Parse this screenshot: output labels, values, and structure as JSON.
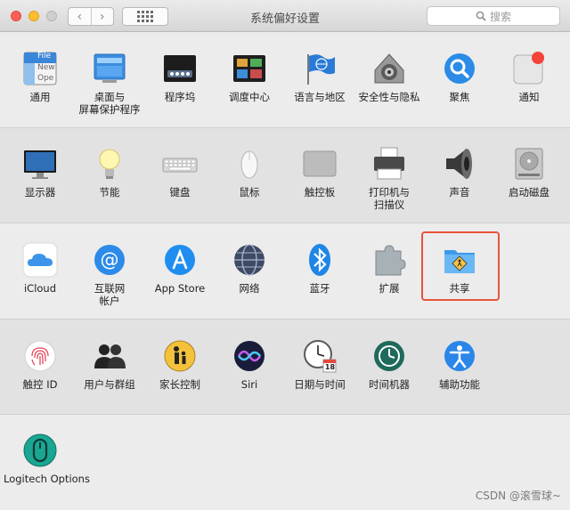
{
  "window": {
    "title": "系统偏好设置",
    "search_placeholder": "搜索",
    "back": "‹",
    "forward": "›"
  },
  "rows": [
    [
      {
        "name": "通用",
        "icon": "general-icon"
      },
      {
        "name": "桌面与\n屏幕保护程序",
        "icon": "desktop-icon"
      },
      {
        "name": "程序坞",
        "icon": "dock-icon"
      },
      {
        "name": "调度中心",
        "icon": "mission-control-icon"
      },
      {
        "name": "语言与地区",
        "icon": "flag-icon"
      },
      {
        "name": "安全性与隐私",
        "icon": "security-icon"
      },
      {
        "name": "聚焦",
        "icon": "spotlight-icon"
      },
      {
        "name": "通知",
        "icon": "notification-icon"
      }
    ],
    [
      {
        "name": "显示器",
        "icon": "display-icon"
      },
      {
        "name": "节能",
        "icon": "bulb-icon"
      },
      {
        "name": "键盘",
        "icon": "keyboard-icon"
      },
      {
        "name": "鼠标",
        "icon": "mouse-icon"
      },
      {
        "name": "触控板",
        "icon": "trackpad-icon"
      },
      {
        "name": "打印机与\n扫描仪",
        "icon": "printer-icon"
      },
      {
        "name": "声音",
        "icon": "speaker-icon"
      },
      {
        "name": "启动磁盘",
        "icon": "disk-icon"
      }
    ],
    [
      {
        "name": "iCloud",
        "icon": "cloud-icon"
      },
      {
        "name": "互联网\n帐户",
        "icon": "at-icon"
      },
      {
        "name": "App Store",
        "icon": "appstore-icon"
      },
      {
        "name": "网络",
        "icon": "globe-icon"
      },
      {
        "name": "蓝牙",
        "icon": "bluetooth-icon"
      },
      {
        "name": "扩展",
        "icon": "puzzle-icon"
      },
      {
        "name": "共享",
        "icon": "sharing-folder-icon"
      }
    ],
    [
      {
        "name": "触控 ID",
        "icon": "fingerprint-icon"
      },
      {
        "name": "用户与群组",
        "icon": "users-icon"
      },
      {
        "name": "家长控制",
        "icon": "parental-icon"
      },
      {
        "name": "Siri",
        "icon": "siri-icon"
      },
      {
        "name": "日期与时间",
        "icon": "clock-icon"
      },
      {
        "name": "时间机器",
        "icon": "time-machine-icon"
      },
      {
        "name": "辅助功能",
        "icon": "accessibility-icon"
      }
    ],
    [
      {
        "name": "Logitech Options",
        "icon": "logitech-icon"
      }
    ]
  ],
  "general_icon_text": [
    "File",
    "New",
    "Ope"
  ],
  "calendar_day": "18",
  "highlighted": "共享",
  "watermark": "CSDN @滚雪球~",
  "colors": {
    "highlight": "#e8533b",
    "accent": "#1e88e5"
  }
}
